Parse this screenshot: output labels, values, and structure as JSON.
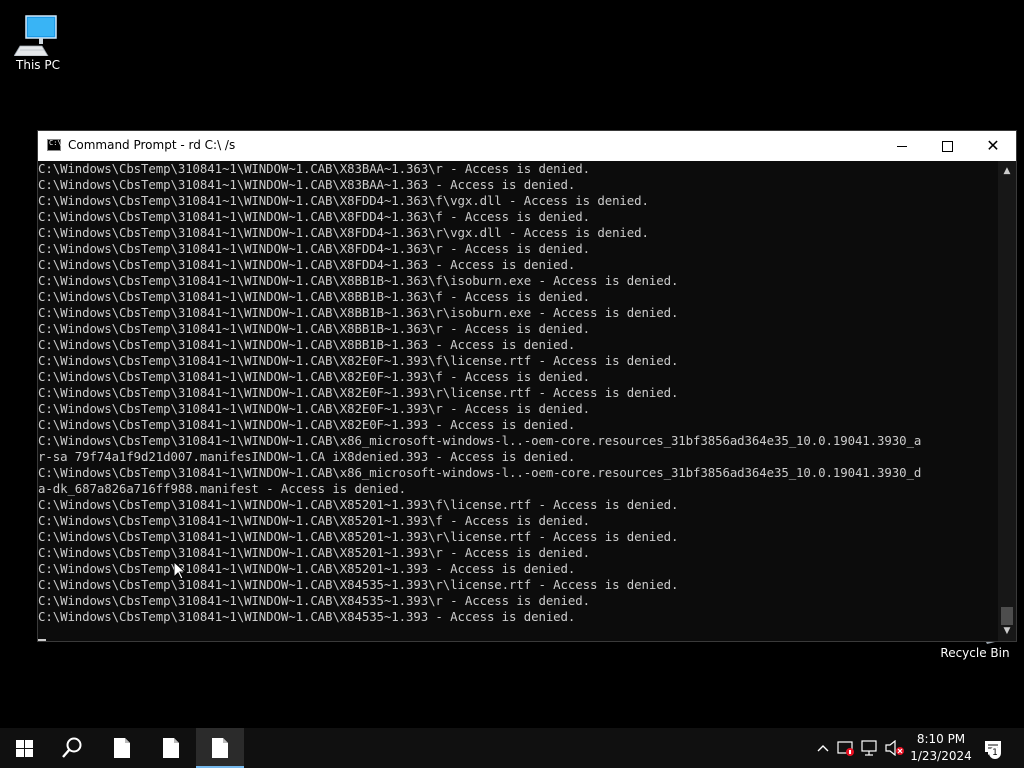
{
  "desktop": {
    "icons": [
      {
        "label": "This PC"
      },
      {
        "label": "Recycle Bin"
      }
    ]
  },
  "window": {
    "title": "Command Prompt - rd  C:\\ /s",
    "lines": [
      "C:\\Windows\\CbsTemp\\310841~1\\WINDOW~1.CAB\\X83BAA~1.363\\r - Access is denied.",
      "C:\\Windows\\CbsTemp\\310841~1\\WINDOW~1.CAB\\X83BAA~1.363 - Access is denied.",
      "C:\\Windows\\CbsTemp\\310841~1\\WINDOW~1.CAB\\X8FDD4~1.363\\f\\vgx.dll - Access is denied.",
      "C:\\Windows\\CbsTemp\\310841~1\\WINDOW~1.CAB\\X8FDD4~1.363\\f - Access is denied.",
      "C:\\Windows\\CbsTemp\\310841~1\\WINDOW~1.CAB\\X8FDD4~1.363\\r\\vgx.dll - Access is denied.",
      "C:\\Windows\\CbsTemp\\310841~1\\WINDOW~1.CAB\\X8FDD4~1.363\\r - Access is denied.",
      "C:\\Windows\\CbsTemp\\310841~1\\WINDOW~1.CAB\\X8FDD4~1.363 - Access is denied.",
      "C:\\Windows\\CbsTemp\\310841~1\\WINDOW~1.CAB\\X8BB1B~1.363\\f\\isoburn.exe - Access is denied.",
      "C:\\Windows\\CbsTemp\\310841~1\\WINDOW~1.CAB\\X8BB1B~1.363\\f - Access is denied.",
      "C:\\Windows\\CbsTemp\\310841~1\\WINDOW~1.CAB\\X8BB1B~1.363\\r\\isoburn.exe - Access is denied.",
      "C:\\Windows\\CbsTemp\\310841~1\\WINDOW~1.CAB\\X8BB1B~1.363\\r - Access is denied.",
      "C:\\Windows\\CbsTemp\\310841~1\\WINDOW~1.CAB\\X8BB1B~1.363 - Access is denied.",
      "C:\\Windows\\CbsTemp\\310841~1\\WINDOW~1.CAB\\X82E0F~1.393\\f\\license.rtf - Access is denied.",
      "C:\\Windows\\CbsTemp\\310841~1\\WINDOW~1.CAB\\X82E0F~1.393\\f - Access is denied.",
      "C:\\Windows\\CbsTemp\\310841~1\\WINDOW~1.CAB\\X82E0F~1.393\\r\\license.rtf - Access is denied.",
      "C:\\Windows\\CbsTemp\\310841~1\\WINDOW~1.CAB\\X82E0F~1.393\\r - Access is denied.",
      "C:\\Windows\\CbsTemp\\310841~1\\WINDOW~1.CAB\\X82E0F~1.393 - Access is denied.",
      "C:\\Windows\\CbsTemp\\310841~1\\WINDOW~1.CAB\\x86_microsoft-windows-l..-oem-core.resources_31bf3856ad364e35_10.0.19041.3930_a",
      "r-sa 79f74a1f9d21d007.manifesINDOW~1.CA iX8denied.393 - Access is denied.",
      "C:\\Windows\\CbsTemp\\310841~1\\WINDOW~1.CAB\\x86_microsoft-windows-l..-oem-core.resources_31bf3856ad364e35_10.0.19041.3930_d",
      "a-dk_687a826a716ff988.manifest - Access is denied.",
      "C:\\Windows\\CbsTemp\\310841~1\\WINDOW~1.CAB\\X85201~1.393\\f\\license.rtf - Access is denied.",
      "C:\\Windows\\CbsTemp\\310841~1\\WINDOW~1.CAB\\X85201~1.393\\f - Access is denied.",
      "C:\\Windows\\CbsTemp\\310841~1\\WINDOW~1.CAB\\X85201~1.393\\r\\license.rtf - Access is denied.",
      "C:\\Windows\\CbsTemp\\310841~1\\WINDOW~1.CAB\\X85201~1.393\\r - Access is denied.",
      "C:\\Windows\\CbsTemp\\310841~1\\WINDOW~1.CAB\\X85201~1.393 - Access is denied.",
      "C:\\Windows\\CbsTemp\\310841~1\\WINDOW~1.CAB\\X84535~1.393\\r\\license.rtf - Access is denied.",
      "C:\\Windows\\CbsTemp\\310841~1\\WINDOW~1.CAB\\X84535~1.393\\r - Access is denied.",
      "C:\\Windows\\CbsTemp\\310841~1\\WINDOW~1.CAB\\X84535~1.393 - Access is denied."
    ]
  },
  "taskbar": {
    "clock": {
      "time": "8:10 PM",
      "date": "1/23/2024"
    },
    "notification_count": "1",
    "icons": [
      "windows-start-icon",
      "search-icon",
      "file-icon",
      "file-icon",
      "command-prompt-icon"
    ],
    "tray_icons": [
      "chevron-up-icon",
      "security-icon",
      "network-icon",
      "volume-muted-icon",
      "notification-icon"
    ]
  },
  "colors": {
    "console_bg": "#0c0c0c",
    "console_text": "#cccccc",
    "taskbar_bg": "#101010",
    "accent": "#76b9ed"
  }
}
